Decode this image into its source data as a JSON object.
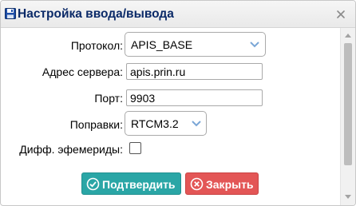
{
  "dialog": {
    "title": "Настройка ввода/вывода",
    "icons": {
      "title": "save-icon",
      "close": "close-icon"
    }
  },
  "form": {
    "protocol": {
      "label": "Протокол:",
      "value": "APIS_BASE"
    },
    "server": {
      "label": "Адрес сервера:",
      "value": "apis.prin.ru"
    },
    "port": {
      "label": "Порт:",
      "value": "9903"
    },
    "corrections": {
      "label": "Поправки:",
      "value": "RTCM3.2"
    },
    "diff_ephemeris": {
      "label": "Дифф. эфемериды:",
      "checked": false
    }
  },
  "buttons": {
    "confirm": {
      "label": "Подтвердить",
      "icon": "check-circle-icon",
      "color": "#2aa6a6"
    },
    "close": {
      "label": "Закрыть",
      "icon": "x-circle-icon",
      "color": "#e35656"
    }
  },
  "colors": {
    "title": "#0b2a68",
    "select_chevron": "#7aa6d6"
  }
}
